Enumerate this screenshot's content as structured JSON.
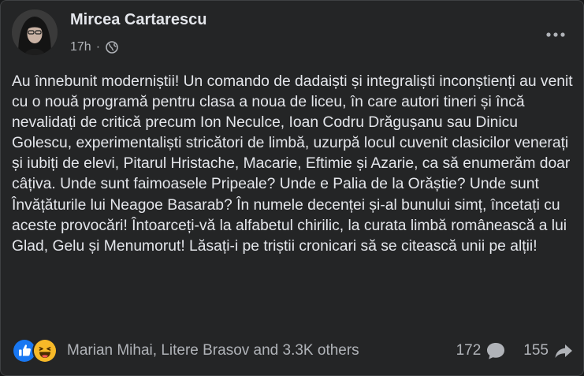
{
  "post": {
    "author": "Mircea Cartarescu",
    "time": "17h",
    "separator": "·",
    "privacy_icon": "globe-icon",
    "more_icon": "more-horizontal-icon",
    "text": "Au înnebunit moderniștii! Un comando de dadaiști și integraliști inconștienți au venit cu o nouă programă pentru clasa a noua de liceu, în care autori tineri și încă nevalidați de critică precum Ion Neculce, Ioan Codru Drăgușanu sau Dinicu Golescu, experimentaliști stricători de limbă, uzurpă locul cuvenit clasicilor venerați și iubiți de elevi, Pitarul Hristache, Macarie, Eftimie și Azarie, ca să enumerăm doar câțiva. Unde sunt faimoasele Pripeale? Unde e Palia de la Orăștie? Unde sunt Învățăturile lui Neagoe Basarab? În numele decenței și-al bunului simț, încetați cu aceste provocări! Întoarceți-vă la alfabetul chirilic, la curata limbă românească a lui Glad, Gelu și Menumorut! Lăsați-i pe triștii cronicari să se citească unii pe alții!"
  },
  "reactions": {
    "icons": [
      "like-icon",
      "haha-icon"
    ],
    "summary": "Marian Mihai, Litere Brasov and 3.3K others"
  },
  "stats": {
    "comments": "172",
    "comments_icon": "comment-bubble-icon",
    "shares": "155",
    "shares_icon": "share-arrow-icon"
  },
  "colors": {
    "card_background": "#242526",
    "primary_text": "#e4e6eb",
    "secondary_text": "#b0b3b8",
    "like_blue": "#1877f2",
    "haha_yellow": "#f7b928"
  }
}
